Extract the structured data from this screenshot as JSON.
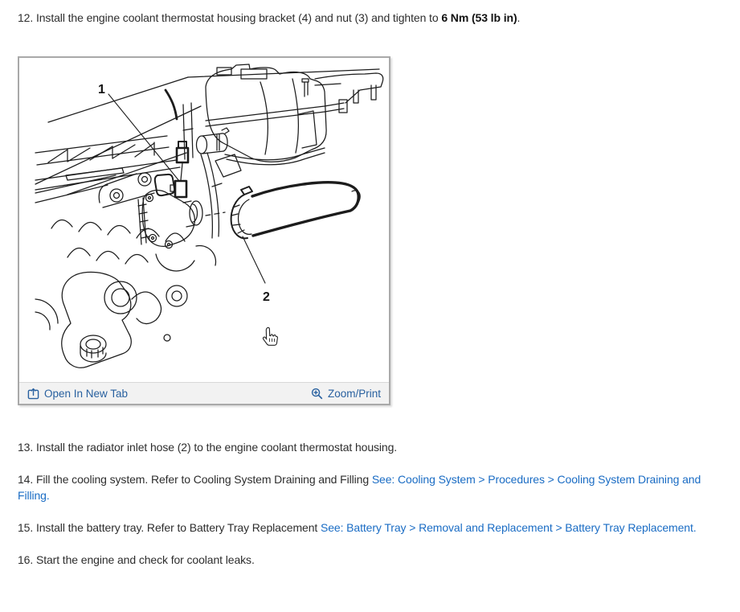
{
  "page": {
    "background": "#ffffff",
    "text_color": "#2d2d2d",
    "inline_link_color": "#1a6cc4",
    "panel_link_color": "#28609f",
    "panel_border_color": "#a9a9a9",
    "footer_bg_color": "#f2f2f2"
  },
  "steps": {
    "step12": {
      "prefix": "12. Install the engine coolant thermostat housing bracket (4) and nut (3) and tighten to ",
      "bold": "6 Nm (53 lb in)",
      "suffix": "."
    },
    "step13": "13. Install the radiator inlet hose (2) to the engine coolant thermostat housing.",
    "step14": {
      "text": "14. Fill the cooling system. Refer to Cooling System Draining and Filling ",
      "link": "See: Cooling System > Procedures > Cooling System Draining and Filling."
    },
    "step15": {
      "text": "15. Install the battery tray. Refer to Battery Tray Replacement ",
      "link": "See: Battery Tray > Removal and Replacement > Battery Tray Replacement."
    },
    "step16": "16. Start the engine and check for coolant leaks."
  },
  "figure": {
    "callouts": [
      "1",
      "2"
    ],
    "footer": {
      "open_label": "Open In New Tab",
      "zoom_label": "Zoom/Print"
    }
  }
}
